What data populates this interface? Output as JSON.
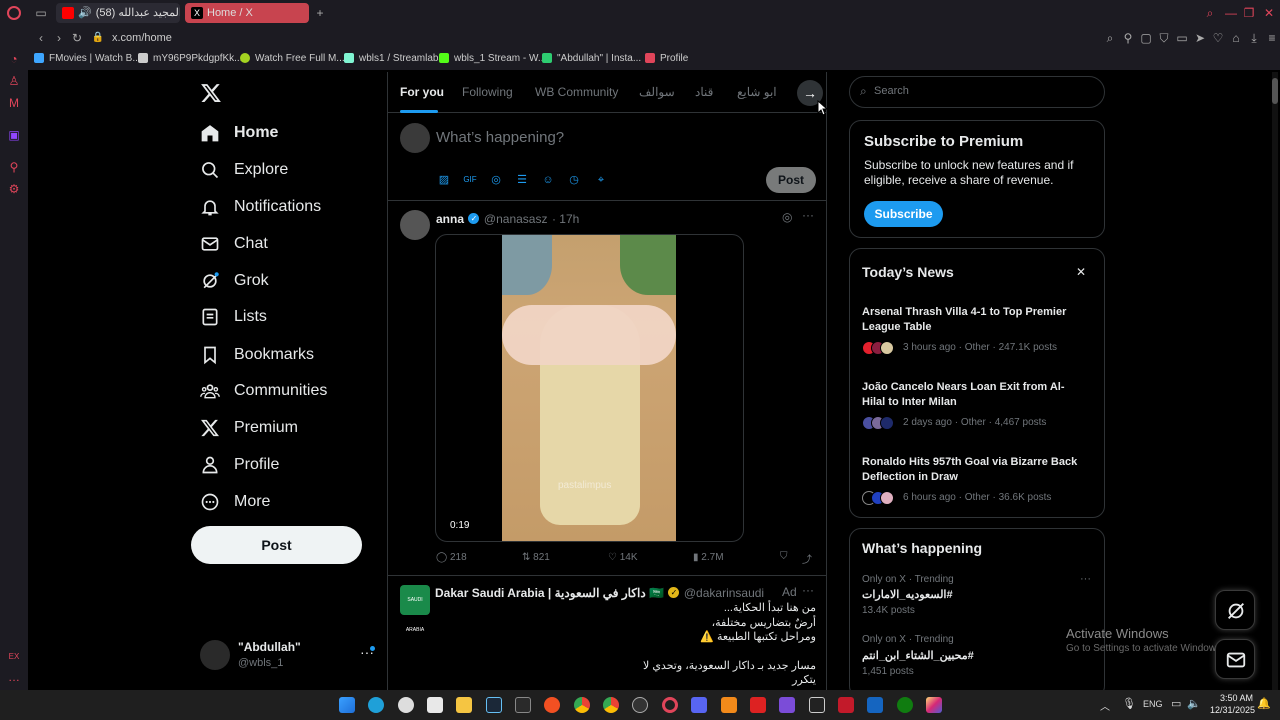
{
  "browser": {
    "tabs": [
      {
        "label": "(58) عبدالمجيد عبدالله -",
        "color": "#ff0000"
      },
      {
        "label": "Home / X",
        "color": "#ffffff"
      }
    ],
    "url": "x.com/home",
    "bookmarks": [
      {
        "label": "FMovies | Watch B...",
        "color": "#3ea6ff"
      },
      {
        "label": "mY96P9PkdgpfKk...",
        "color": "#cccccc"
      },
      {
        "label": "Watch Free Full M...",
        "color": "#a4d321"
      },
      {
        "label": "wbls1 / Streamlabs",
        "color": "#80f5d2"
      },
      {
        "label": "wbls_1 Stream - W...",
        "color": "#53fc18"
      },
      {
        "label": "\"Abdullah\" | Insta...",
        "color": "#2ecc71"
      },
      {
        "label": "Profile",
        "color": "#e0455a"
      }
    ]
  },
  "nav": {
    "items": [
      {
        "label": "Home",
        "icon": "home-icon"
      },
      {
        "label": "Explore",
        "icon": "search-icon"
      },
      {
        "label": "Notifications",
        "icon": "bell-icon"
      },
      {
        "label": "Chat",
        "icon": "mail-icon"
      },
      {
        "label": "Grok",
        "icon": "grok-icon"
      },
      {
        "label": "Lists",
        "icon": "list-icon"
      },
      {
        "label": "Bookmarks",
        "icon": "bookmark-icon"
      },
      {
        "label": "Communities",
        "icon": "communities-icon"
      },
      {
        "label": "Premium",
        "icon": "x-logo-icon"
      },
      {
        "label": "Profile",
        "icon": "person-icon"
      },
      {
        "label": "More",
        "icon": "more-circle-icon"
      }
    ],
    "post_label": "Post",
    "account": {
      "name": "\"Abdullah\"",
      "handle": "@wbls_1"
    }
  },
  "feed": {
    "tabs": [
      "For you",
      "Following",
      "WB Community",
      "سوالف",
      "قناد",
      "ابو شايع"
    ],
    "composer_placeholder": "What’s happening?",
    "composer_post": "Post",
    "tweet1": {
      "name": "anna",
      "handle": "@nanasasz",
      "time": "· 17h",
      "video_time": "0:19",
      "watermark": "pastalimpus",
      "replies": "218",
      "reposts": "821",
      "likes": "14K",
      "views": "2.7M"
    },
    "tweet2": {
      "name": "Dakar Saudi Arabia | داكار في السعودية 🇸🇦",
      "handle": "@dakarinsaudi",
      "ad": "Ad",
      "logo_text": "SAUDI ARABIA",
      "lines": [
        "من هنا تبدأ الحكاية...",
        "أرضٌ بتضاريس مختلفة،",
        "ومراحل تكتبها الطبيعة ⚠️",
        "",
        "مسار جديد بـ داكار السعودية، وتحدي لا",
        "يتكرر"
      ]
    }
  },
  "right": {
    "search_placeholder": "Search",
    "premium": {
      "title": "Subscribe to Premium",
      "body": "Subscribe to unlock new features and if eligible, receive a share of revenue.",
      "button": "Subscribe"
    },
    "news": {
      "title": "Today’s News",
      "items": [
        {
          "title": "Arsenal Thrash Villa 4-1 to Top Premier League Table",
          "meta": "3 hours ago · Other · 247.1K posts"
        },
        {
          "title": "João Cancelo Nears Loan Exit from Al-Hilal to Inter Milan",
          "meta": "2 days ago · Other · 4,467 posts"
        },
        {
          "title": "Ronaldo Hits 957th Goal via Bizarre Back Deflection in Draw",
          "meta": "6 hours ago · Other · 36.6K posts"
        }
      ]
    },
    "happening": {
      "title": "What’s happening",
      "items": [
        {
          "context": "Only on X · Trending",
          "tag": "#السعوديه_الامارات",
          "posts": "13.4K posts"
        },
        {
          "context": "Only on X · Trending",
          "tag": "#محبين_الشتاء_ابن_انتم",
          "posts": "1,451 posts"
        }
      ]
    }
  },
  "watermark": {
    "title": "Activate Windows",
    "sub": "Go to Settings to activate Windows."
  },
  "taskbar": {
    "lang": "ENG",
    "time": "3:50 AM",
    "date": "12/31/2025"
  }
}
